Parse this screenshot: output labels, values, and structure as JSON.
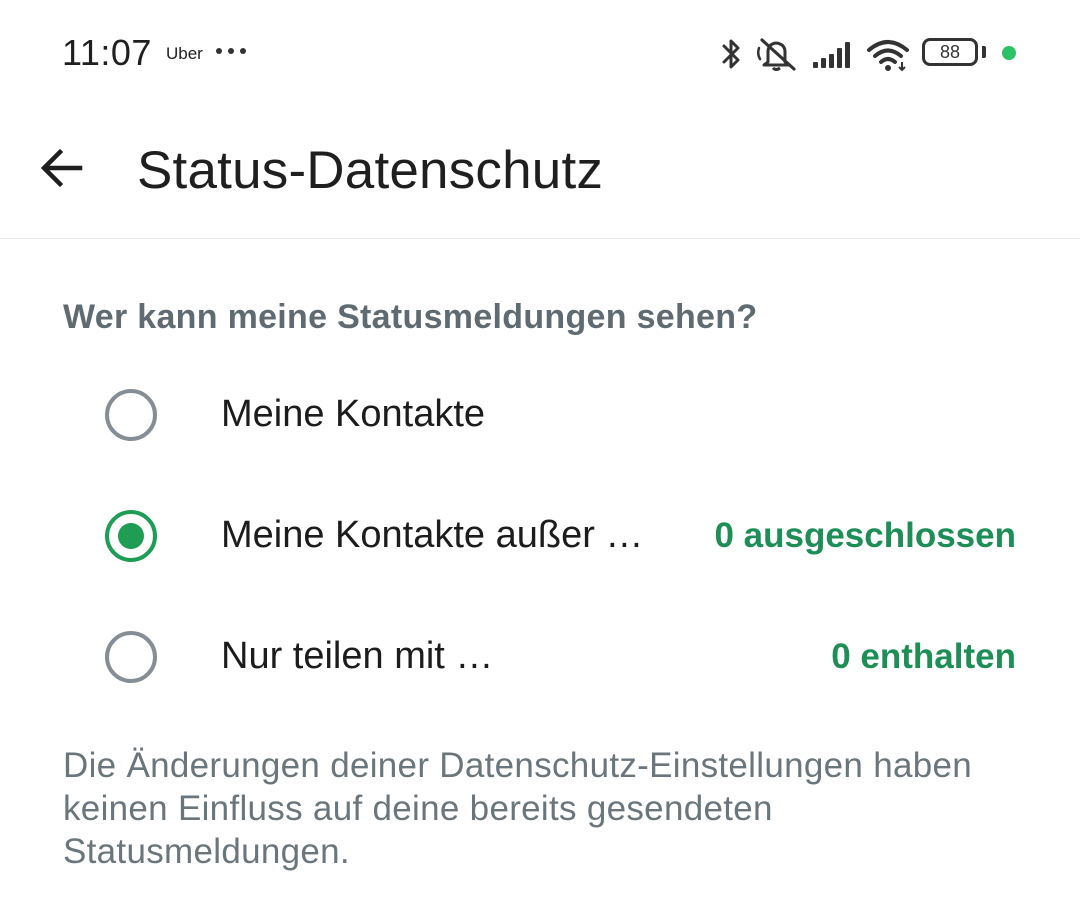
{
  "status_bar": {
    "time": "11:07",
    "app_label": "Uber",
    "battery": "88",
    "icons": [
      "bluetooth-icon",
      "mute-icon",
      "signal-icon",
      "wifi-icon",
      "battery-icon"
    ],
    "indicator_color": "#2cc164"
  },
  "header": {
    "back_icon": "arrow-left-icon",
    "title": "Status-Datenschutz"
  },
  "main": {
    "question": "Wer kann meine Statusmeldungen sehen?",
    "options": [
      {
        "label": "Meine Kontakte",
        "count": "",
        "selected": false
      },
      {
        "label": "Meine Kontakte außer …",
        "count": "0 ausgeschlossen",
        "selected": true
      },
      {
        "label": "Nur teilen mit …",
        "count": "0 enthalten",
        "selected": false
      }
    ],
    "footnote": "Die Änderungen deiner Datenschutz-Einstellungen haben keinen Einfluss auf deine bereits gesendeten Statusmeldungen."
  },
  "colors": {
    "accent": "#1f9d55",
    "accent_text": "#1e8e57",
    "heading_text": "#5f6b71",
    "radio_unchecked": "#858e94"
  }
}
